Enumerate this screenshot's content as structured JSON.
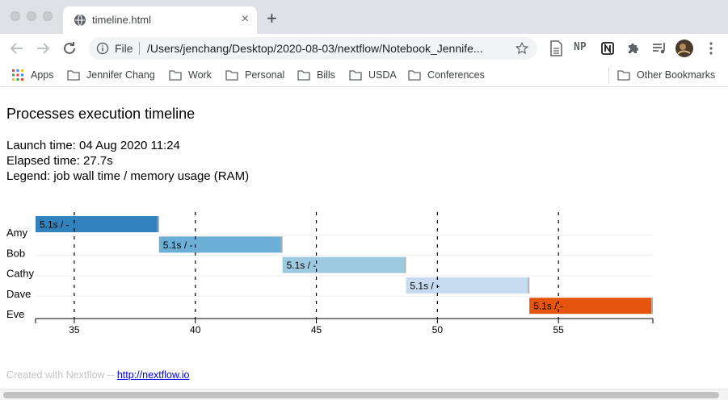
{
  "browser": {
    "tab_title": "timeline.html",
    "tab_close": "×",
    "new_tab": "+",
    "scheme_label": "File",
    "url": "/Users/jenchang/Desktop/2020-08-03/nextflow/Notebook_Jennife...",
    "extensions": [
      "NP"
    ]
  },
  "bookmarks": {
    "items": [
      "Apps",
      "Jennifer Chang",
      "Work",
      "Personal",
      "Bills",
      "USDA",
      "Conferences"
    ],
    "other": "Other Bookmarks"
  },
  "page": {
    "title": "Processes execution timeline",
    "launch": "Launch time: 04 Aug 2020 11:24",
    "elapsed": "Elapsed time: 27.7s",
    "legend": "Legend: job wall time / memory usage (RAM)",
    "footer_text": "Created with Nextflow -- ",
    "footer_link": "http://nextflow.io"
  },
  "chart_data": {
    "type": "bar",
    "orientation": "horizontal-gantt",
    "categories": [
      "Amy",
      "Bob",
      "Cathy",
      "Dave",
      "Eve"
    ],
    "start": [
      33.4,
      38.5,
      43.6,
      48.7,
      53.8
    ],
    "end": [
      38.5,
      43.6,
      48.7,
      53.8,
      58.9
    ],
    "labels": [
      "5.1s / -",
      "5.1s / -",
      "5.1s / -",
      "5.1s / -",
      "5.1s / -"
    ],
    "colors": [
      "#3182bd",
      "#6baed6",
      "#9ecae1",
      "#c6dbef",
      "#e6550d"
    ],
    "xticks": [
      35,
      40,
      45,
      50,
      55
    ],
    "xlim": [
      33.4,
      58.9
    ],
    "grid": "dashed vertical at ticks"
  }
}
